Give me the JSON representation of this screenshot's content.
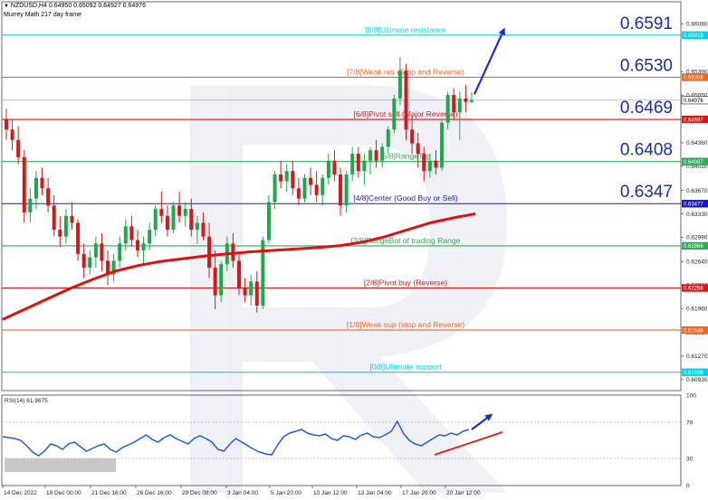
{
  "header": {
    "symbol_line": "NZDUSD,H4  0.64950 0.65092 0.64927 0.64976",
    "indicator_line": "Murrey Math 217 day frame"
  },
  "rsi": {
    "label": "RSI(14) 61.9675",
    "scale": [
      "100",
      "70",
      "30",
      "0"
    ],
    "levels": [
      0,
      30,
      70,
      100
    ]
  },
  "colors": {
    "ultimate": "#00d4e8",
    "weak": "#ee6622",
    "pivot": "#d81818",
    "range": "#36a85a",
    "center": "#1818c8",
    "ma": "#dd1111",
    "bull": "#1ea84a",
    "bear": "#d81818",
    "arrow": "#1a2be0"
  },
  "chart_data": [
    {
      "type": "candlestick",
      "title": "",
      "y_scale": [
        "0.66080",
        "0.65390",
        "0.65050",
        "0.64360",
        "0.64020",
        "0.63670",
        "0.63330",
        "0.62990",
        "0.62640",
        "0.62300",
        "0.61960",
        "0.61610",
        "0.61270",
        "0.60930"
      ],
      "x_ticks": [
        "14 Dec 2022",
        "19 Dec 00:00",
        "21 Dec 16:00",
        "26 Dec 16:00",
        "29 Dec 08:00",
        "3 Jan 04:00",
        "5 Jan 20:00",
        "10 Jan 12:00",
        "13 Jan 04:00",
        "17 Jan 20:00",
        "20 Jan 12:00"
      ],
      "levels": [
        {
          "label": "[8/8]Ultimate resistance",
          "value": 0.65918,
          "tag": "0.65918",
          "big": "0.6591",
          "color_key": "ultimate"
        },
        {
          "label": "[7/8]Weak res (Stop and Reverse)",
          "value": 0.65308,
          "tag": "0.65308",
          "big": "0.6530",
          "color_key": "weak"
        },
        {
          "label": "[6/8]Pivot sell (Major Reverse)",
          "value": 0.64697,
          "tag": "0.64697",
          "big": "0.6469",
          "color_key": "pivot"
        },
        {
          "label": "[5/8]RangeTop",
          "value": 0.64087,
          "tag": "0.64087",
          "big": "0.6408",
          "color_key": "range"
        },
        {
          "label": "[4/8]Center (Good Buy or Sell)",
          "value": 0.63477,
          "tag": "0.63477",
          "big": "0.6347",
          "color_key": "center"
        },
        {
          "label": "[3/8]RangeBot of trading Range",
          "value": 0.62866,
          "tag": "0.62866",
          "big": "",
          "color_key": "range"
        },
        {
          "label": "[2/8]Pivot buy (Reverse)",
          "value": 0.62256,
          "tag": "0.62256",
          "big": "",
          "color_key": "pivot"
        },
        {
          "label": "[1/8]Weak sup (stop and Reverse)",
          "value": 0.61646,
          "tag": "0.61646",
          "big": "",
          "color_key": "weak"
        },
        {
          "label": "[0/8]Ultimate support",
          "value": 0.61036,
          "tag": "0.61036",
          "big": "",
          "color_key": "ultimate"
        }
      ],
      "last_price": {
        "value": 0.64976,
        "tag": "0.64976"
      },
      "ylim": [
        0.6077,
        0.664
      ],
      "ohlc": [
        [
          0.647,
          0.6485,
          0.644,
          0.6455
        ],
        [
          0.6455,
          0.647,
          0.6425,
          0.644
        ],
        [
          0.644,
          0.646,
          0.6405,
          0.6415
        ],
        [
          0.6415,
          0.6425,
          0.632,
          0.6335
        ],
        [
          0.6335,
          0.637,
          0.632,
          0.6355
        ],
        [
          0.6355,
          0.6395,
          0.634,
          0.6385
        ],
        [
          0.6385,
          0.64,
          0.636,
          0.637
        ],
        [
          0.637,
          0.6385,
          0.6335,
          0.6345
        ],
        [
          0.6345,
          0.636,
          0.63,
          0.631
        ],
        [
          0.631,
          0.633,
          0.6285,
          0.63
        ],
        [
          0.63,
          0.634,
          0.629,
          0.633
        ],
        [
          0.633,
          0.635,
          0.631,
          0.632
        ],
        [
          0.632,
          0.6325,
          0.6265,
          0.6275
        ],
        [
          0.6275,
          0.629,
          0.624,
          0.6255
        ],
        [
          0.6255,
          0.628,
          0.6245,
          0.627
        ],
        [
          0.627,
          0.63,
          0.6255,
          0.629
        ],
        [
          0.629,
          0.6305,
          0.625,
          0.6265
        ],
        [
          0.6265,
          0.628,
          0.623,
          0.6245
        ],
        [
          0.6245,
          0.6275,
          0.6235,
          0.6265
        ],
        [
          0.6265,
          0.63,
          0.6255,
          0.629
        ],
        [
          0.629,
          0.6325,
          0.628,
          0.6315
        ],
        [
          0.6315,
          0.633,
          0.6285,
          0.6295
        ],
        [
          0.6295,
          0.631,
          0.627,
          0.628
        ],
        [
          0.628,
          0.63,
          0.626,
          0.629
        ],
        [
          0.629,
          0.632,
          0.628,
          0.631
        ],
        [
          0.631,
          0.6345,
          0.63,
          0.634
        ],
        [
          0.634,
          0.6365,
          0.632,
          0.633
        ],
        [
          0.633,
          0.6345,
          0.63,
          0.631
        ],
        [
          0.631,
          0.635,
          0.6305,
          0.6345
        ],
        [
          0.6345,
          0.6365,
          0.632,
          0.633
        ],
        [
          0.633,
          0.635,
          0.6315,
          0.634
        ],
        [
          0.634,
          0.6355,
          0.63,
          0.631
        ],
        [
          0.631,
          0.633,
          0.629,
          0.632
        ],
        [
          0.632,
          0.6335,
          0.6295,
          0.63
        ],
        [
          0.63,
          0.632,
          0.624,
          0.6255
        ],
        [
          0.6255,
          0.628,
          0.6195,
          0.6215
        ],
        [
          0.6215,
          0.6265,
          0.6205,
          0.626
        ],
        [
          0.626,
          0.63,
          0.625,
          0.629
        ],
        [
          0.629,
          0.6305,
          0.6255,
          0.6265
        ],
        [
          0.6265,
          0.6275,
          0.6215,
          0.6225
        ],
        [
          0.6225,
          0.624,
          0.6205,
          0.6215
        ],
        [
          0.6215,
          0.6245,
          0.62,
          0.6235
        ],
        [
          0.6235,
          0.625,
          0.619,
          0.62
        ],
        [
          0.62,
          0.63,
          0.6195,
          0.6295
        ],
        [
          0.6295,
          0.636,
          0.629,
          0.635
        ],
        [
          0.635,
          0.6395,
          0.634,
          0.639
        ],
        [
          0.639,
          0.641,
          0.637,
          0.638
        ],
        [
          0.638,
          0.6405,
          0.6365,
          0.6395
        ],
        [
          0.6395,
          0.641,
          0.636,
          0.637
        ],
        [
          0.637,
          0.6385,
          0.6345,
          0.6355
        ],
        [
          0.6355,
          0.639,
          0.635,
          0.6385
        ],
        [
          0.6385,
          0.64,
          0.636,
          0.6375
        ],
        [
          0.6375,
          0.6395,
          0.635,
          0.636
        ],
        [
          0.636,
          0.639,
          0.6345,
          0.6385
        ],
        [
          0.6385,
          0.642,
          0.6375,
          0.641
        ],
        [
          0.641,
          0.6425,
          0.638,
          0.639
        ],
        [
          0.639,
          0.64,
          0.633,
          0.6345
        ],
        [
          0.6345,
          0.6395,
          0.6335,
          0.639
        ],
        [
          0.639,
          0.643,
          0.638,
          0.642
        ],
        [
          0.642,
          0.643,
          0.6385,
          0.6395
        ],
        [
          0.6395,
          0.642,
          0.6375,
          0.641
        ],
        [
          0.641,
          0.643,
          0.639,
          0.6425
        ],
        [
          0.6425,
          0.644,
          0.64,
          0.641
        ],
        [
          0.641,
          0.6435,
          0.64,
          0.643
        ],
        [
          0.643,
          0.646,
          0.642,
          0.6455
        ],
        [
          0.6455,
          0.6505,
          0.645,
          0.65
        ],
        [
          0.65,
          0.656,
          0.649,
          0.654
        ],
        [
          0.654,
          0.655,
          0.644,
          0.6455
        ],
        [
          0.6455,
          0.6475,
          0.642,
          0.6435
        ],
        [
          0.6435,
          0.645,
          0.64,
          0.642
        ],
        [
          0.642,
          0.643,
          0.638,
          0.6395
        ],
        [
          0.6395,
          0.642,
          0.6385,
          0.641
        ],
        [
          0.641,
          0.6425,
          0.639,
          0.64
        ],
        [
          0.64,
          0.647,
          0.6395,
          0.6465
        ],
        [
          0.6465,
          0.651,
          0.6455,
          0.6505
        ],
        [
          0.6505,
          0.6515,
          0.647,
          0.648
        ],
        [
          0.648,
          0.651,
          0.644,
          0.65
        ],
        [
          0.65,
          0.652,
          0.648,
          0.6495
        ],
        [
          0.6495,
          0.6509,
          0.6493,
          0.64976
        ]
      ],
      "ma_label": "",
      "ma": [
        0.618,
        0.6195,
        0.621,
        0.6225,
        0.6238,
        0.625,
        0.6258,
        0.6264,
        0.6268,
        0.6272,
        0.6275,
        0.6278,
        0.628,
        0.6282,
        0.6284,
        0.6287,
        0.6292,
        0.63,
        0.631,
        0.632,
        0.6327,
        0.6333
      ],
      "rsi_values": [
        54,
        53,
        52,
        50,
        44,
        37,
        33,
        38,
        46,
        44,
        40,
        46,
        48,
        43,
        38,
        41,
        44,
        46,
        40,
        37,
        42,
        45,
        48,
        52,
        56,
        51,
        48,
        53,
        56,
        52,
        49,
        46,
        52,
        55,
        52,
        48,
        40,
        38,
        46,
        52,
        48,
        44,
        40,
        37,
        35,
        34,
        45,
        54,
        58,
        60,
        62,
        58,
        56,
        55,
        57,
        52,
        50,
        55,
        54,
        51,
        56,
        58,
        54,
        53,
        56,
        60,
        71,
        58,
        50,
        46,
        44,
        48,
        52,
        56,
        55,
        58,
        56,
        60,
        62
      ]
    }
  ]
}
